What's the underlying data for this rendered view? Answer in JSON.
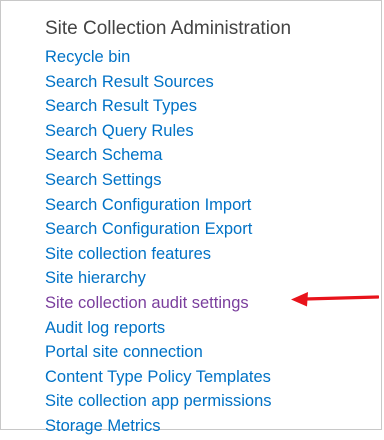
{
  "section": {
    "title": "Site Collection Administration",
    "links": [
      {
        "label": "Recycle bin"
      },
      {
        "label": "Search Result Sources"
      },
      {
        "label": "Search Result Types"
      },
      {
        "label": "Search Query Rules"
      },
      {
        "label": "Search Schema"
      },
      {
        "label": "Search Settings"
      },
      {
        "label": "Search Configuration Import"
      },
      {
        "label": "Search Configuration Export"
      },
      {
        "label": "Site collection features"
      },
      {
        "label": "Site hierarchy"
      },
      {
        "label": "Site collection audit settings",
        "state": "visited"
      },
      {
        "label": "Audit log reports"
      },
      {
        "label": "Portal site connection"
      },
      {
        "label": "Content Type Policy Templates"
      },
      {
        "label": "Site collection app permissions"
      },
      {
        "label": "Storage Metrics"
      }
    ]
  },
  "colors": {
    "link": "#0072c6",
    "visited_link": "#7a3e9d",
    "heading": "#444444",
    "annotation_arrow": "#e8131b"
  },
  "annotation": {
    "icon": "red-arrow-pointing-left"
  }
}
